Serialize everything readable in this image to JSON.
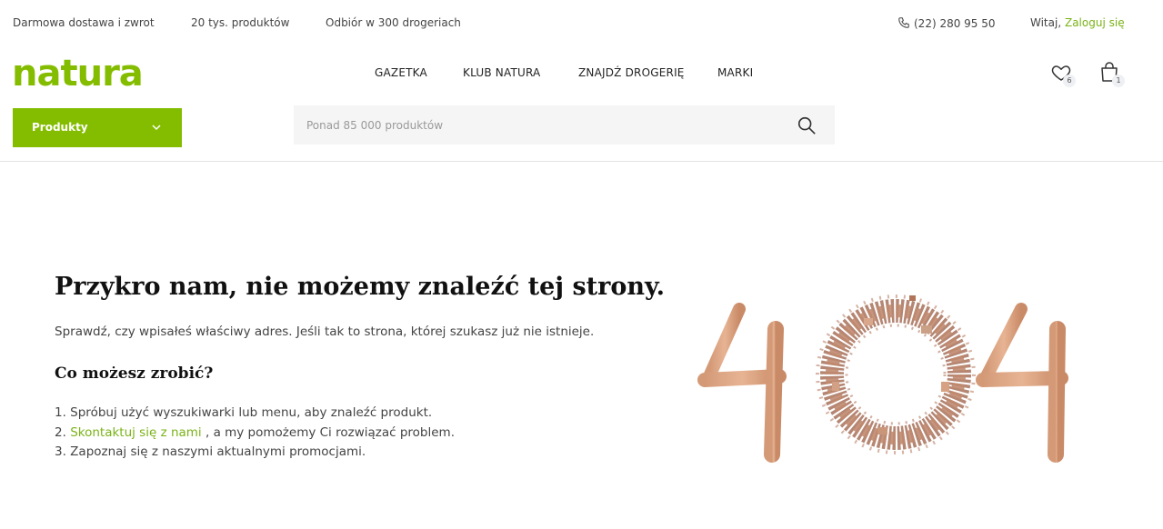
{
  "topbar": {
    "shipping": "Darmowa dostawa i zwrot",
    "products_count": "20 tys. produktów",
    "pickup": "Odbiór w 300 drogeriach",
    "phone": "(22) 280 95 50",
    "greeting": "Witaj,",
    "login_link": "Zaloguj się"
  },
  "header": {
    "logo": "natura",
    "nav": [
      "GAZETKA",
      "KLUB NATURA",
      "ZNAJDŹ DROGERIĘ",
      "MARKI"
    ],
    "wishlist_count": "6",
    "cart_count": "1"
  },
  "products_menu": {
    "label": "Produkty"
  },
  "search": {
    "placeholder": "Ponad 85 000 produktów",
    "value": ""
  },
  "error_page": {
    "title": "Przykro nam, nie możemy znaleźć tej strony.",
    "lead": "Sprawdź, czy wpisałeś właściwy adres. Jeśli tak to strona, której szukasz już nie istnieje.",
    "subtitle": "Co możesz zrobić?",
    "step1": "1. Spróbuj użyć wyszukiwarki lub menu, aby znaleźć produkt.",
    "step2_prefix": "2.",
    "step2_link": "Skontaktuj się z nami",
    "step2_suffix": ", a my pomożemy Ci rozwiązać problem.",
    "step3": "3. Zapoznaj się z naszymi aktualnymi promocjami."
  },
  "colors": {
    "accent": "#84bd00",
    "link": "#7ab317",
    "search_bg": "#f5f5f5"
  },
  "icons": [
    "phone-icon",
    "heart-icon",
    "bag-icon",
    "chevron-down-icon",
    "search-icon"
  ]
}
